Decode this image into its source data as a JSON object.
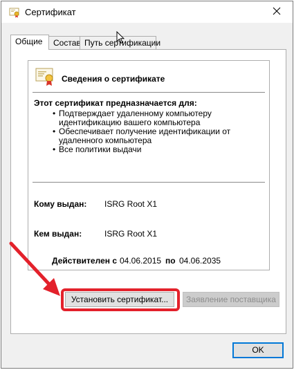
{
  "window": {
    "title": "Сертификат",
    "icon": "certificate-icon",
    "close_icon": "close-icon"
  },
  "tabs": [
    {
      "label": "Общие",
      "active": true
    },
    {
      "label": "Состав",
      "active": false
    },
    {
      "label": "Путь сертификации",
      "active": false
    }
  ],
  "cert": {
    "header_title": "Сведения о сертификате",
    "purpose_heading": "Этот сертификат предназначается для:",
    "purposes": [
      "Подтверждает удаленному компьютеру идентификацию вашего компьютера",
      "Обеспечивает получение идентификации от удаленного компьютера",
      "Все политики выдачи"
    ],
    "issued_to_label": "Кому выдан:",
    "issued_to_value": "ISRG Root X1",
    "issued_by_label": "Кем выдан:",
    "issued_by_value": "ISRG Root X1",
    "valid_from_label": "Действителен с",
    "valid_from_value": "04.06.2015",
    "valid_to_label": "по",
    "valid_to_value": "04.06.2035"
  },
  "buttons": {
    "install": "Установить сертификат...",
    "issuer_statement": "Заявление поставщика",
    "ok": "OK"
  },
  "colors": {
    "highlight": "#e3212b",
    "ok_border": "#0078d7"
  }
}
